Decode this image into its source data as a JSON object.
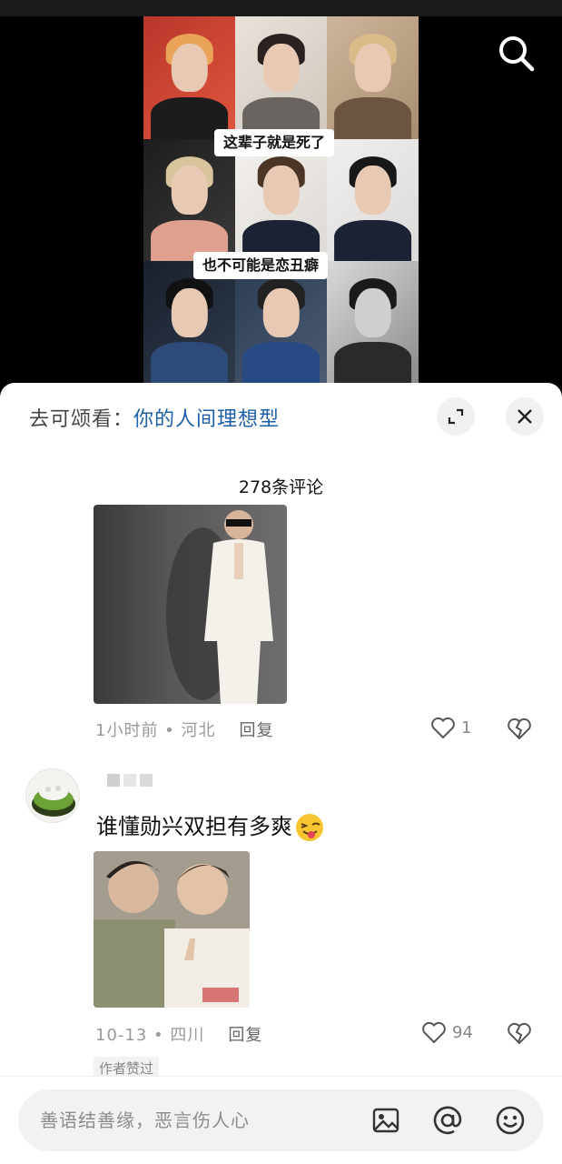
{
  "video": {
    "caption_top": "这辈子就是死了",
    "caption_bottom": "也不可能是恋丑癖"
  },
  "sheet": {
    "link_prefix": "去可颂看：",
    "link_title": "你的人间理想型",
    "comment_count": "278条评论"
  },
  "comments": [
    {
      "time": "1小时前",
      "location": "河北",
      "reply_label": "回复",
      "likes": "1"
    },
    {
      "username_hidden": true,
      "text": "谁懂勋兴双担有多爽",
      "time": "10-13",
      "location": "四川",
      "reply_label": "回复",
      "likes": "94",
      "badge": "作者赞过"
    }
  ],
  "composer": {
    "placeholder": "善语结善缘，恶言伤人心"
  },
  "icons": {
    "search": "search-icon",
    "expand": "expand-icon",
    "close": "close-icon",
    "like": "heart-icon",
    "dislike": "broken-heart-icon",
    "image": "image-icon",
    "mention": "at-icon",
    "emoji": "smiley-icon"
  },
  "colors": {
    "link_blue": "#1d5fa8",
    "meta_gray": "#9a9a9a",
    "sheet_bg": "#ffffff",
    "video_bg": "#000000"
  }
}
